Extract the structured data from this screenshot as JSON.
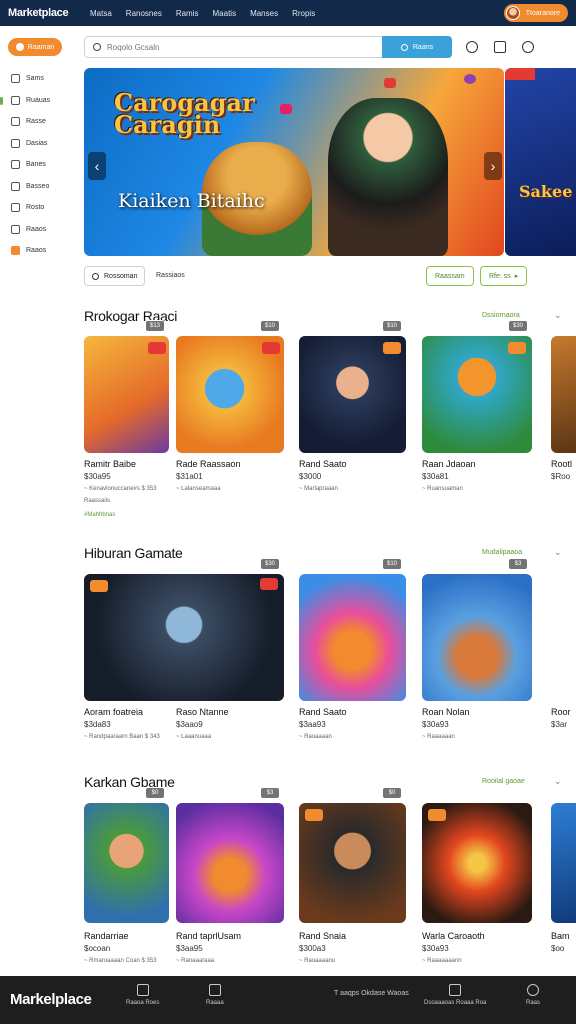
{
  "app": {
    "logo": "Marketplace"
  },
  "topnav": {
    "items": [
      "Matsa",
      "Ranosnes",
      "Ramis",
      "Maatis",
      "Manses",
      "Rropis"
    ]
  },
  "account": {
    "label": "Ttoaranore"
  },
  "sidebar": {
    "button_label": "Raaman",
    "items": [
      {
        "label": "Sams"
      },
      {
        "label": "Ruauas"
      },
      {
        "label": "Rasse"
      },
      {
        "label": "Dasias"
      },
      {
        "label": "Banes"
      },
      {
        "label": "Basseo"
      },
      {
        "label": "Rosto"
      },
      {
        "label": "Raaos"
      },
      {
        "label": "Raaos"
      }
    ]
  },
  "search": {
    "placeholder": "Roqolo Gcsaln",
    "button_label": "Raans"
  },
  "hero": {
    "title": "Carogagar Caragin",
    "subtitle": "Kiaiken Bitaihc",
    "side_title": "Sakee"
  },
  "filters": {
    "search_chip": "Rossoman",
    "text": "Rassiaos",
    "chip1": "Raassam",
    "chip2": "Rfe: ss"
  },
  "sections": [
    {
      "title": "Rrokogar Raaci",
      "see_all": "Dssiornaora",
      "cards": [
        {
          "name": "Ramitr Baibe",
          "price": "$30a95",
          "info": "~ Kenavlonuccane#s $ 353",
          "extra": "Raassaiis",
          "tag": "#Mahhbnas",
          "badge_price": "$13"
        },
        {
          "name": "Rade Raassaon",
          "price": "$31a01",
          "info": "~ Lalanseamaaa",
          "extra": "",
          "tag": "",
          "badge_price": "$10"
        },
        {
          "name": "Rand Saato",
          "price": "$3000",
          "info": "~ Marlapraaan",
          "extra": "",
          "tag": "",
          "badge_price": "$10"
        },
        {
          "name": "Raan Jdaoan",
          "price": "$30a81",
          "info": "~ Ruansuaman",
          "extra": "",
          "tag": "",
          "badge_price": "$30"
        },
        {
          "name": "Rootl",
          "price": "$Roo",
          "info": "",
          "extra": "",
          "tag": "",
          "badge_price": ""
        }
      ]
    },
    {
      "title": "Hiburan Gamate",
      "see_all": "Mudalipaaoa",
      "cards": [
        {
          "name": "Aoram foatreia",
          "price": "$3da83",
          "info": "~ Randpaaraarn Baan $ 343",
          "extra": "",
          "tag": "",
          "badge_price": "$30"
        },
        {
          "name": "Raso Ntanne",
          "price": "$3aao9",
          "info": "~ Laaanuaaa",
          "extra": "",
          "tag": "",
          "badge_price": ""
        },
        {
          "name": "Rand Saato",
          "price": "$3aa93",
          "info": "~ Rauaaaan",
          "extra": "",
          "tag": "",
          "badge_price": "$10"
        },
        {
          "name": "Roan Nolan",
          "price": "$30a93",
          "info": "~ Raaaaaan",
          "extra": "",
          "tag": "",
          "badge_price": "$3"
        },
        {
          "name": "Roor",
          "price": "$3ar",
          "info": "",
          "extra": "",
          "tag": "",
          "badge_price": ""
        }
      ]
    },
    {
      "title": "Karkan Gbame",
      "see_all": "Rooilal gaoae",
      "cards": [
        {
          "name": "Randarriae",
          "price": "$ocoan",
          "info": "~ Rmaroaaaan Coan $ 353",
          "extra": "",
          "tag": "",
          "badge_price": "$0"
        },
        {
          "name": "Rand taprlUsam",
          "price": "$3aa95",
          "info": "~ Ranaaaraaa",
          "extra": "",
          "tag": "",
          "badge_price": "$3"
        },
        {
          "name": "Rand Snaia",
          "price": "$300a3",
          "info": "~ Rauaaaanu",
          "extra": "",
          "tag": "",
          "badge_price": "$0"
        },
        {
          "name": "Warla Caroaoth",
          "price": "$30a93",
          "info": "~ Raaaaaaann",
          "extra": "",
          "tag": "",
          "badge_price": ""
        },
        {
          "name": "Bam",
          "price": "$oo",
          "info": "",
          "extra": "",
          "tag": "",
          "badge_price": ""
        }
      ]
    }
  ],
  "bottombar": {
    "logo": "Markelplace",
    "items": [
      "Raaoa Roes",
      "Raaaa",
      "Dsoaaaoas Roaaa Roa",
      "Raas"
    ],
    "center": "T aaqps Okdase Waoas"
  },
  "colors": {
    "nav_bg": "#12294a",
    "accent_orange": "#f28a2e",
    "accent_blue": "#3aa2d8",
    "accent_green": "#5d9b2e",
    "bottom_bg": "#1e1e1e"
  }
}
